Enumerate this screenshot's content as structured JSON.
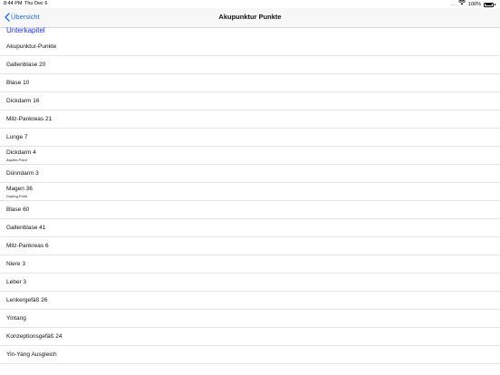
{
  "status_bar": {
    "time": "8:44 PM",
    "date": "Thu Dec 6",
    "signal": ".....",
    "battery_percent": "100%"
  },
  "nav": {
    "back_label": "Übersicht",
    "title": "Akupunktur Punkte"
  },
  "section": {
    "header": "Unterkapitel"
  },
  "rows": [
    {
      "title": "Akupunktur-Punkte",
      "subtitle": ""
    },
    {
      "title": "Gallenblase 20",
      "subtitle": ""
    },
    {
      "title": "Blase 10",
      "subtitle": ""
    },
    {
      "title": "Dickdarm 16",
      "subtitle": ""
    },
    {
      "title": "Milz-Pankreas 21",
      "subtitle": ""
    },
    {
      "title": "Lunge 7",
      "subtitle": ""
    },
    {
      "title": "Dickdarm 4",
      "subtitle": "Aspirin-Point"
    },
    {
      "title": "Dünndarm 3",
      "subtitle": ""
    },
    {
      "title": "Magen 36",
      "subtitle": "Doping-Point"
    },
    {
      "title": "Blase 60",
      "subtitle": ""
    },
    {
      "title": "Gallenblase 41",
      "subtitle": ""
    },
    {
      "title": "Milz-Pankreas 6",
      "subtitle": ""
    },
    {
      "title": "Niere 3",
      "subtitle": ""
    },
    {
      "title": "Leber 3",
      "subtitle": ""
    },
    {
      "title": "Lenkergefäß 26",
      "subtitle": ""
    },
    {
      "title": "Yintang",
      "subtitle": ""
    },
    {
      "title": "Konzeptionsgefäß 24",
      "subtitle": ""
    },
    {
      "title": "Yin-Yang Ausgleich",
      "subtitle": ""
    }
  ],
  "colors": {
    "accent": "#1a6cf2",
    "section_header": "#1a2ff5",
    "navbar_bg": "#f7f7f7"
  }
}
